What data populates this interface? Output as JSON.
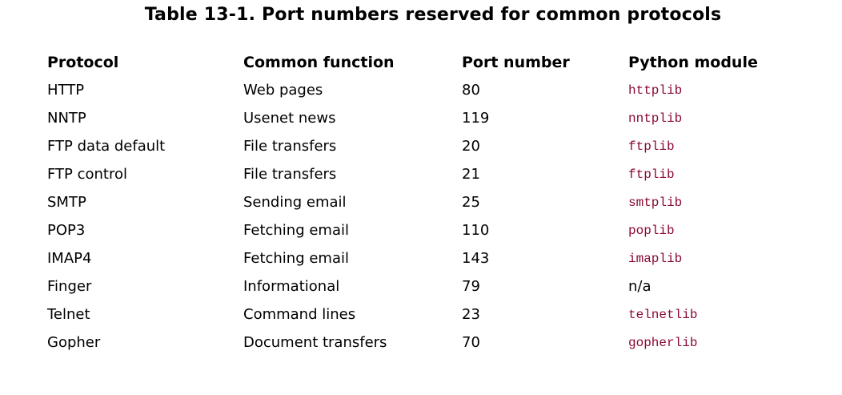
{
  "title": "Table 13-1. Port numbers reserved for common protocols",
  "headers": [
    "Protocol",
    "Common function",
    "Port number",
    "Python module"
  ],
  "rows": [
    {
      "protocol": "HTTP",
      "function": "Web pages",
      "port": "80",
      "module": "httplib",
      "module_code": true
    },
    {
      "protocol": "NNTP",
      "function": "Usenet news",
      "port": "119",
      "module": "nntplib",
      "module_code": true
    },
    {
      "protocol": "FTP data default",
      "function": "File transfers",
      "port": "20",
      "module": "ftplib",
      "module_code": true
    },
    {
      "protocol": "FTP control",
      "function": "File transfers",
      "port": "21",
      "module": "ftplib",
      "module_code": true
    },
    {
      "protocol": "SMTP",
      "function": "Sending email",
      "port": "25",
      "module": "smtplib",
      "module_code": true
    },
    {
      "protocol": "POP3",
      "function": "Fetching email",
      "port": "110",
      "module": "poplib",
      "module_code": true
    },
    {
      "protocol": "IMAP4",
      "function": "Fetching email",
      "port": "143",
      "module": "imaplib",
      "module_code": true
    },
    {
      "protocol": "Finger",
      "function": "Informational",
      "port": "79",
      "module": "n/a",
      "module_code": false
    },
    {
      "protocol": "Telnet",
      "function": "Command lines",
      "port": "23",
      "module": "telnetlib",
      "module_code": true
    },
    {
      "protocol": "Gopher",
      "function": "Document transfers",
      "port": "70",
      "module": "gopherlib",
      "module_code": true
    }
  ],
  "colors": {
    "code_text": "#8b0a32",
    "body_text": "#000000"
  }
}
